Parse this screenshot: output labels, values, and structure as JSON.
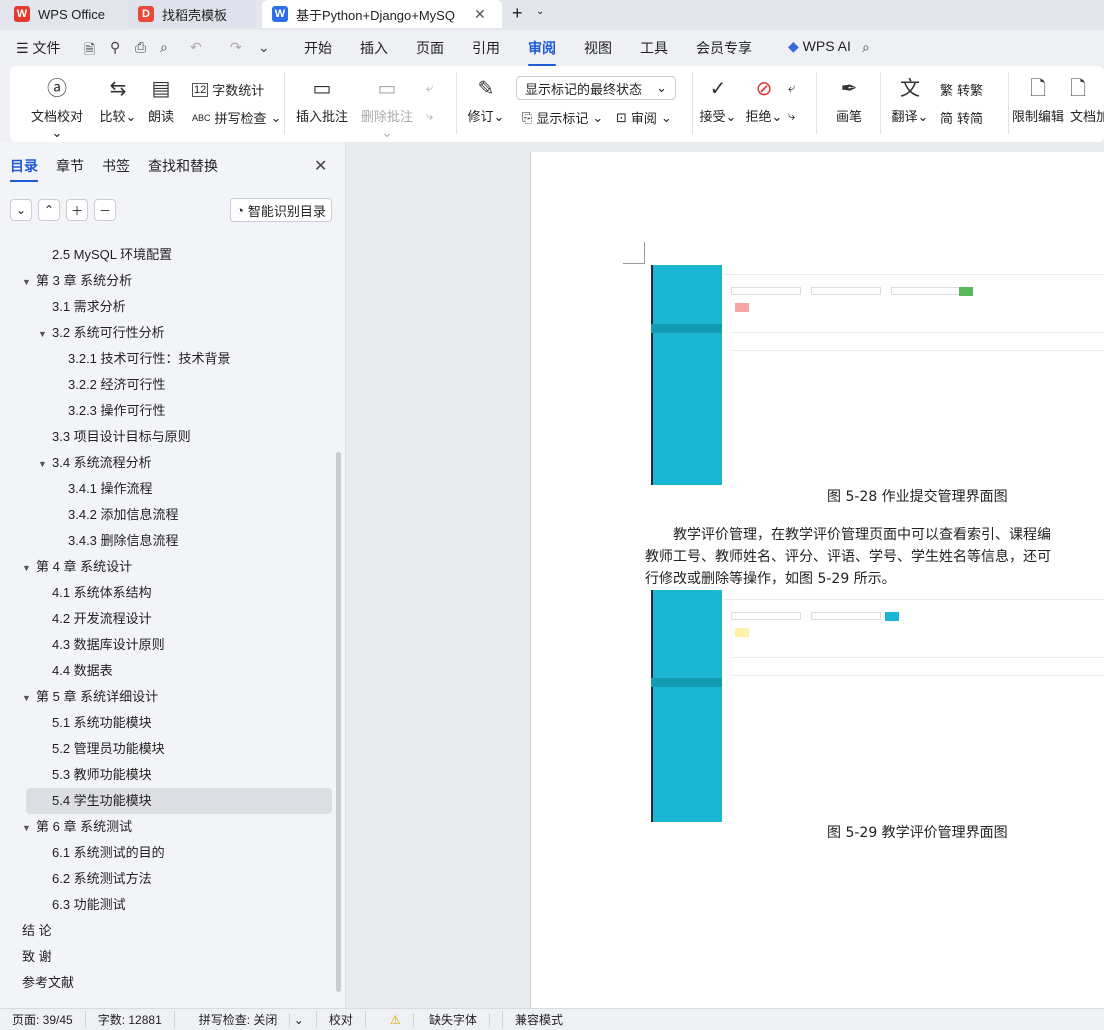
{
  "tabs": [
    {
      "label": "WPS Office",
      "icon": "wps-logo-icon"
    },
    {
      "label": "找稻壳模板",
      "icon": "docer-icon"
    },
    {
      "label": "基于Python+Django+MySQ",
      "icon": "word-doc-icon"
    }
  ],
  "menu": {
    "file": "文件",
    "items": [
      "开始",
      "插入",
      "页面",
      "引用",
      "审阅",
      "视图",
      "工具",
      "会员专享"
    ],
    "active": "审阅",
    "ai": "WPS AI"
  },
  "ribbon": {
    "proof": "文档校对",
    "compare": "比较",
    "read": "朗读",
    "wordcount": "字数统计",
    "spell": "拼写检查",
    "insert_comment": "插入批注",
    "delete_comment": "删除批注",
    "revise": "修订",
    "markup_state": "显示标记的最终状态",
    "show_markup": "显示标记",
    "review_pane": "审阅",
    "accept": "接受",
    "reject": "拒绝",
    "pen": "画笔",
    "translate": "翻译",
    "to_traditional": "转繁",
    "to_simplified": "转简",
    "restrict": "限制编辑",
    "doc_enc": "文档加"
  },
  "nav": {
    "tabs": [
      "目录",
      "章节",
      "书签",
      "查找和替换"
    ],
    "smart_btn": "智能识别目录",
    "toc": [
      {
        "t": "2.5 MySQL 环境配置",
        "l": 2
      },
      {
        "t": "第 3 章  系统分析",
        "l": 1,
        "a": "▼"
      },
      {
        "t": "3.1  需求分析",
        "l": 2
      },
      {
        "t": "3.2  系统可行性分析",
        "l": 2,
        "a": "▼"
      },
      {
        "t": "3.2.1 技术可行性：技术背景",
        "l": 3
      },
      {
        "t": "3.2.2 经济可行性",
        "l": 3
      },
      {
        "t": "3.2.3 操作可行性",
        "l": 3
      },
      {
        "t": "3.3  项目设计目标与原则",
        "l": 2
      },
      {
        "t": "3.4 系统流程分析",
        "l": 2,
        "a": "▼"
      },
      {
        "t": "3.4.1 操作流程",
        "l": 3
      },
      {
        "t": "3.4.2 添加信息流程",
        "l": 3
      },
      {
        "t": "3.4.3 删除信息流程",
        "l": 3
      },
      {
        "t": "第 4 章  系统设计",
        "l": 1,
        "a": "▼"
      },
      {
        "t": "4.1  系统体系结构",
        "l": 2
      },
      {
        "t": "4.2 开发流程设计",
        "l": 2
      },
      {
        "t": "4.3  数据库设计原则",
        "l": 2
      },
      {
        "t": "4.4  数据表",
        "l": 2
      },
      {
        "t": "第 5 章  系统详细设计",
        "l": 1,
        "a": "▼"
      },
      {
        "t": "5.1 系统功能模块",
        "l": 2
      },
      {
        "t": "5.2 管理员功能模块",
        "l": 2
      },
      {
        "t": "5.3 教师功能模块",
        "l": 2
      },
      {
        "t": "5.4 学生功能模块",
        "l": 2,
        "sel": true
      },
      {
        "t": "第 6 章    系统测试",
        "l": 1,
        "a": "▼"
      },
      {
        "t": "6.1 系统测试的目的",
        "l": 2
      },
      {
        "t": "6.2 系统测试方法",
        "l": 2
      },
      {
        "t": "6.3 功能测试",
        "l": 2
      },
      {
        "t": "结   论",
        "l": 1
      },
      {
        "t": "致   谢",
        "l": 1
      },
      {
        "t": "参考文献",
        "l": 1
      }
    ]
  },
  "doc": {
    "cap1": "图 5-28 作业提交管理界面图",
    "para": [
      "教学评价管理，在教学评价管理页面中可以查看索引、课程编",
      "教师工号、教师姓名、评分、评语、学号、学生姓名等信息，还可",
      "行修改或删除等操作，如图 5-29 所示。"
    ],
    "cap2": "图 5-29 教学评价管理界面图"
  },
  "status": {
    "page": "页面: 39/45",
    "words": "字数: 12881",
    "spell": "拼写检查: 关闭",
    "proof": "校对",
    "font": "缺失字体",
    "compat": "兼容模式"
  }
}
